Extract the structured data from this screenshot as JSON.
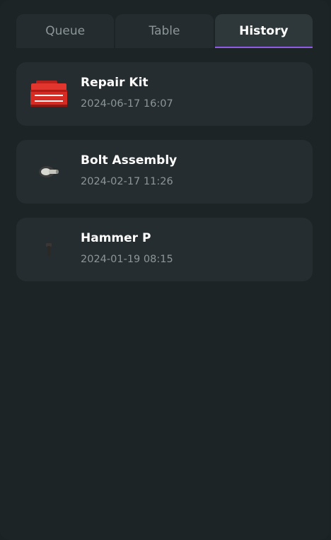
{
  "tabs": [
    {
      "label": "Queue",
      "active": false
    },
    {
      "label": "Table",
      "active": false
    },
    {
      "label": "History",
      "active": true
    }
  ],
  "history": [
    {
      "name": "Repair Kit",
      "date": "2024-06-17 16:07",
      "icon": "toolbox-icon"
    },
    {
      "name": "Bolt Assembly",
      "date": "2024-02-17 11:26",
      "icon": "bolt-assembly-icon"
    },
    {
      "name": "Hammer P",
      "date": "2024-01-19 08:15",
      "icon": "hammer-icon"
    }
  ],
  "colors": {
    "background": "#1d2426",
    "card": "#252d30",
    "tab": "#242c2f",
    "tab_active": "#2e383b",
    "accent": "#8f5be8",
    "text_primary": "#ffffff",
    "text_secondary": "#8c969a"
  }
}
